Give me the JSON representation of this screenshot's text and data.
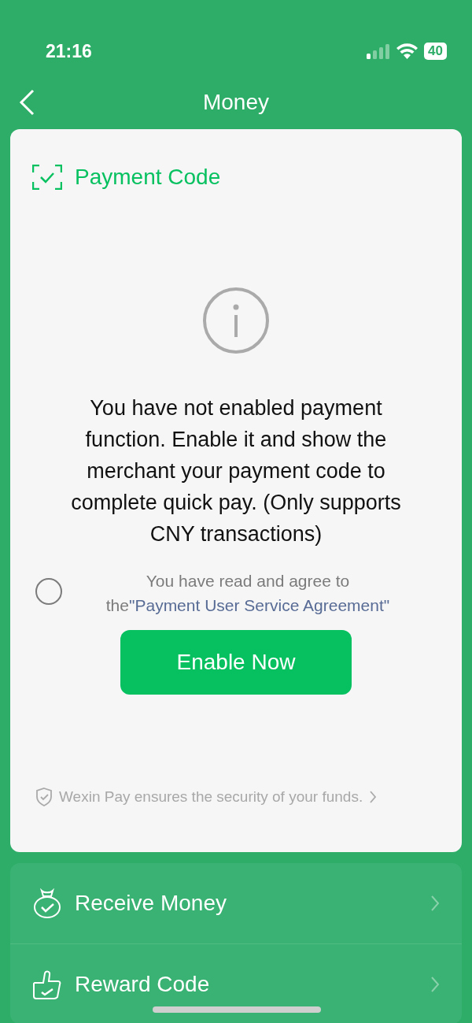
{
  "status_bar": {
    "time": "21:16",
    "battery": "40"
  },
  "nav": {
    "title": "Money"
  },
  "payment_card": {
    "title": "Payment Code",
    "message": "You have not enabled payment function. Enable it and show the merchant your payment code to complete quick pay. (Only supports CNY transactions)",
    "agreement": {
      "checked": false,
      "text": "You have read and agree to the",
      "link": "\"Payment User Service Agreement\""
    },
    "button": "Enable Now",
    "security_note": "Wexin Pay ensures the security of your funds."
  },
  "menu": [
    {
      "kind": "receive",
      "label": "Receive Money"
    },
    {
      "kind": "reward",
      "label": "Reward Code"
    }
  ]
}
